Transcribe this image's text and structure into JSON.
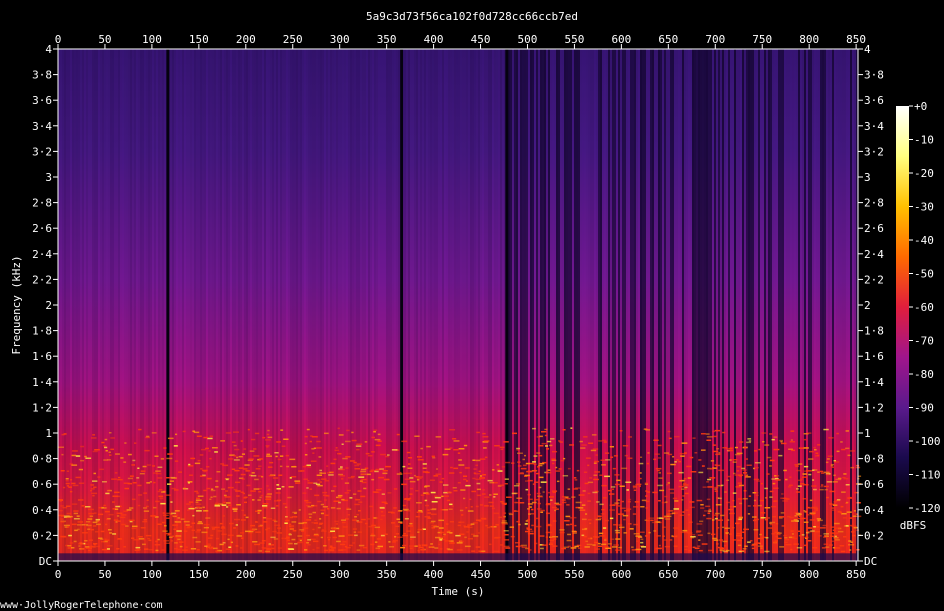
{
  "chart_data": {
    "type": "heatmap",
    "title": "5a9c3d73f56ca102f0d728cc66ccb7ed",
    "xlabel": "Time (s)",
    "ylabel": "Frequency (kHz)",
    "x_ticks": [
      "0",
      "50",
      "100",
      "150",
      "200",
      "250",
      "300",
      "350",
      "400",
      "450",
      "500",
      "550",
      "600",
      "650",
      "700",
      "750",
      "800",
      "850"
    ],
    "x_tick_values": [
      0,
      50,
      100,
      150,
      200,
      250,
      300,
      350,
      400,
      450,
      500,
      550,
      600,
      650,
      700,
      750,
      800,
      850
    ],
    "y_ticks": [
      "DC",
      "0·2",
      "0·4",
      "0·6",
      "0·8",
      "1",
      "1·2",
      "1·4",
      "1·6",
      "1·8",
      "2",
      "2·2",
      "2·4",
      "2·6",
      "2·8",
      "3",
      "3·2",
      "3·4",
      "3·6",
      "3·8",
      "4"
    ],
    "y_tick_values": [
      0,
      0.2,
      0.4,
      0.6,
      0.8,
      1,
      1.2,
      1.4,
      1.6,
      1.8,
      2,
      2.2,
      2.4,
      2.6,
      2.8,
      3,
      3.2,
      3.4,
      3.6,
      3.8,
      4
    ],
    "xlim": [
      0,
      852
    ],
    "ylim": [
      0,
      4
    ],
    "colorbar": {
      "label": "dBFS",
      "ticks": [
        "+0",
        "-10",
        "-20",
        "-30",
        "-40",
        "-50",
        "-60",
        "-70",
        "-80",
        "-90",
        "-100",
        "-110",
        "-120"
      ],
      "values": [
        0,
        -10,
        -20,
        -30,
        -40,
        -50,
        -60,
        -70,
        -80,
        -90,
        -100,
        -110,
        -120
      ],
      "range": [
        -120,
        0
      ],
      "colors": [
        "#000000",
        "#1a0a4d",
        "#5a1a8c",
        "#a0158c",
        "#e01e3c",
        "#ff6a00",
        "#ffc000",
        "#ffff80",
        "#ffffff"
      ]
    },
    "silence_gaps_s": [
      117,
      366,
      478
    ]
  },
  "footer": "www·JollyRogerTelephone·com"
}
